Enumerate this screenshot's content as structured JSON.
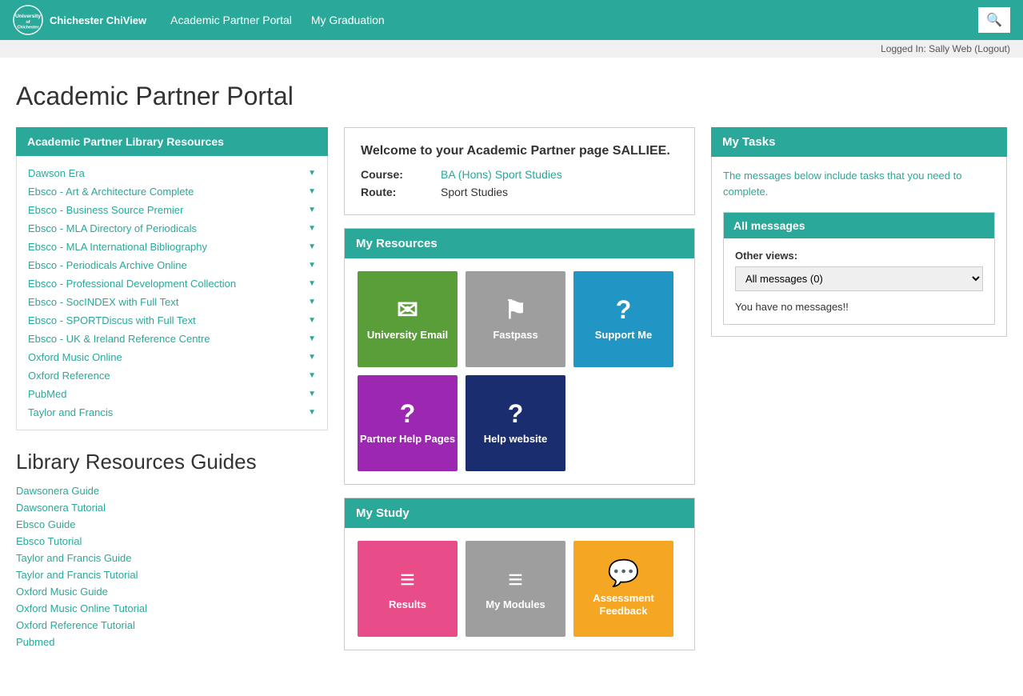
{
  "header": {
    "logo_line1": "University",
    "logo_line2": "of",
    "logo_line3": "Chichester ChiView",
    "nav": [
      {
        "label": "Academic Partner Portal",
        "id": "nav-portal"
      },
      {
        "label": "My Graduation",
        "id": "nav-graduation"
      }
    ],
    "logged_in_text": "Logged In: Sally Web (Logout)"
  },
  "page": {
    "title": "Academic Partner Portal"
  },
  "left": {
    "library_section_title": "Academic Partner Library Resources",
    "resources": [
      "Dawson Era",
      "Ebsco - Art & Architecture Complete",
      "Ebsco - Business Source Premier",
      "Ebsco - MLA Directory of Periodicals",
      "Ebsco - MLA International Bibliography",
      "Ebsco - Periodicals Archive Online",
      "Ebsco - Professional Development Collection",
      "Ebsco - SocINDEX with Full Text",
      "Ebsco - SPORTDiscus with Full Text",
      "Ebsco - UK & Ireland Reference Centre",
      "Oxford Music Online",
      "Oxford Reference",
      "PubMed",
      "Taylor and Francis"
    ],
    "guides_title": "Library Resources Guides",
    "guides": [
      "Dawsonera Guide",
      "Dawsonera Tutorial",
      "Ebsco Guide",
      "Ebsco Tutorial",
      "Taylor and Francis Guide",
      "Taylor and Francis Tutorial",
      "Oxford Music Guide",
      "Oxford Music Online Tutorial",
      "Oxford Reference Tutorial",
      "Pubmed"
    ]
  },
  "center": {
    "welcome": {
      "title": "Welcome to your Academic Partner page SALLIEE.",
      "course_label": "Course:",
      "course_value": "BA (Hons) Sport Studies",
      "route_label": "Route:",
      "route_value": "Sport Studies"
    },
    "my_resources": {
      "section_title": "My Resources",
      "tiles": [
        {
          "label": "University Email",
          "color": "tile-green",
          "icon": "✉"
        },
        {
          "label": "Fastpass",
          "color": "tile-gray",
          "icon": "⚑"
        },
        {
          "label": "Support Me",
          "color": "tile-blue",
          "icon": "?"
        },
        {
          "label": "Partner Help Pages",
          "color": "tile-purple",
          "icon": "?"
        },
        {
          "label": "Help website",
          "color": "tile-dark-blue",
          "icon": "?"
        }
      ]
    },
    "my_study": {
      "section_title": "My Study",
      "tiles": [
        {
          "label": "Results",
          "color": "tile-pink",
          "icon": "≡"
        },
        {
          "label": "My Modules",
          "color": "tile-gray2",
          "icon": "≡"
        },
        {
          "label": "Assessment Feedback",
          "color": "tile-orange",
          "icon": "💬"
        }
      ]
    }
  },
  "right": {
    "tasks_title": "My Tasks",
    "tasks_desc": "The messages below include tasks that you need to complete.",
    "all_messages_title": "All messages",
    "other_views_label": "Other views:",
    "messages_select_value": "All messages (0)",
    "no_messages_text": "You have no messages!!"
  }
}
